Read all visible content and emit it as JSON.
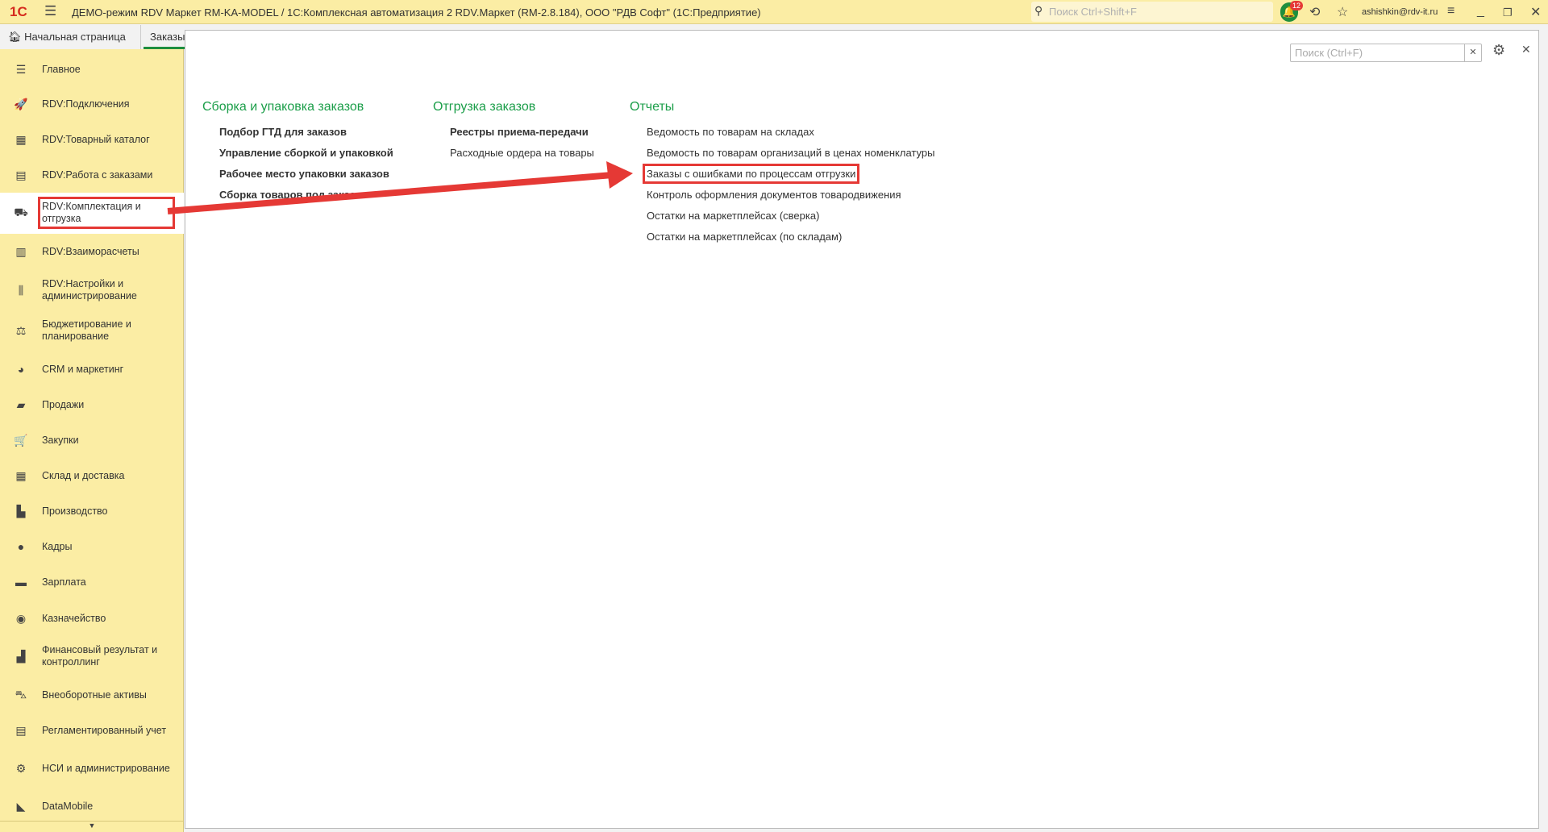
{
  "titlebar": {
    "title": "ДЕМО-режим RDV Маркет RM-KA-MODEL / 1С:Комплексная автоматизация 2 RDV.Маркет (RM-2.8.184), ООО \"РДВ Софт\"  (1С:Предприятие)",
    "search_placeholder": "Поиск Ctrl+Shift+F",
    "notifications": "12",
    "user": "ashishkin@rdv-it.ru",
    "logo": "1С"
  },
  "tabs": [
    {
      "label": "Начальная страница"
    },
    {
      "label": "Заказы"
    }
  ],
  "sidebar": {
    "items": [
      {
        "label": "Главное",
        "icon": "☰"
      },
      {
        "label": "RDV:Подключения",
        "icon": "🚀"
      },
      {
        "label": "RDV:Товарный каталог",
        "icon": "▦"
      },
      {
        "label": "RDV:Работа с заказами",
        "icon": "▤"
      },
      {
        "label": "RDV:Комплектация и отгрузка",
        "icon": "⛟"
      },
      {
        "label": "RDV:Взаиморасчеты",
        "icon": "▥"
      },
      {
        "label": "RDV:Настройки и администрирование",
        "icon": "⫼"
      },
      {
        "label": "Бюджетирование и планирование",
        "icon": "⚖"
      },
      {
        "label": "CRM и маркетинг",
        "icon": "◕"
      },
      {
        "label": "Продажи",
        "icon": "▰"
      },
      {
        "label": "Закупки",
        "icon": "🛒"
      },
      {
        "label": "Склад и доставка",
        "icon": "▦"
      },
      {
        "label": "Производство",
        "icon": "▙"
      },
      {
        "label": "Кадры",
        "icon": "●"
      },
      {
        "label": "Зарплата",
        "icon": "▬"
      },
      {
        "label": "Казначейство",
        "icon": "◉"
      },
      {
        "label": "Финансовый результат и контроллинг",
        "icon": "▟"
      },
      {
        "label": "Внеоборотные активы",
        "icon": "⛍"
      },
      {
        "label": "Регламентированный учет",
        "icon": "▤"
      },
      {
        "label": "НСИ и администрирование",
        "icon": "⚙"
      },
      {
        "label": "DataMobile",
        "icon": "◣"
      }
    ]
  },
  "main": {
    "search_placeholder": "Поиск (Ctrl+F)",
    "columns": [
      {
        "title": "Сборка и упаковка заказов",
        "items": [
          "Подбор ГТД для заказов",
          "Управление сборкой и упаковкой",
          "Рабочее место упаковки заказов",
          "Сборка товаров под заказы"
        ]
      },
      {
        "title": "Отгрузка заказов",
        "items": [
          "Реестры приема-передачи",
          "Расходные ордера на товары"
        ]
      },
      {
        "title": "Отчеты",
        "items": [
          "Ведомость по товарам на складах",
          "Ведомость по товарам организаций в ценах номенклатуры",
          "Заказы с ошибками по процессам отгрузки",
          "Контроль оформления документов товародвижения",
          "Остатки на маркетплейсах (сверка)",
          "Остатки на маркетплейсах (по складам)"
        ]
      }
    ]
  },
  "colors": {
    "accent": "#1b9e49",
    "sidebar": "#fbeda4",
    "annotation": "#e53935"
  }
}
